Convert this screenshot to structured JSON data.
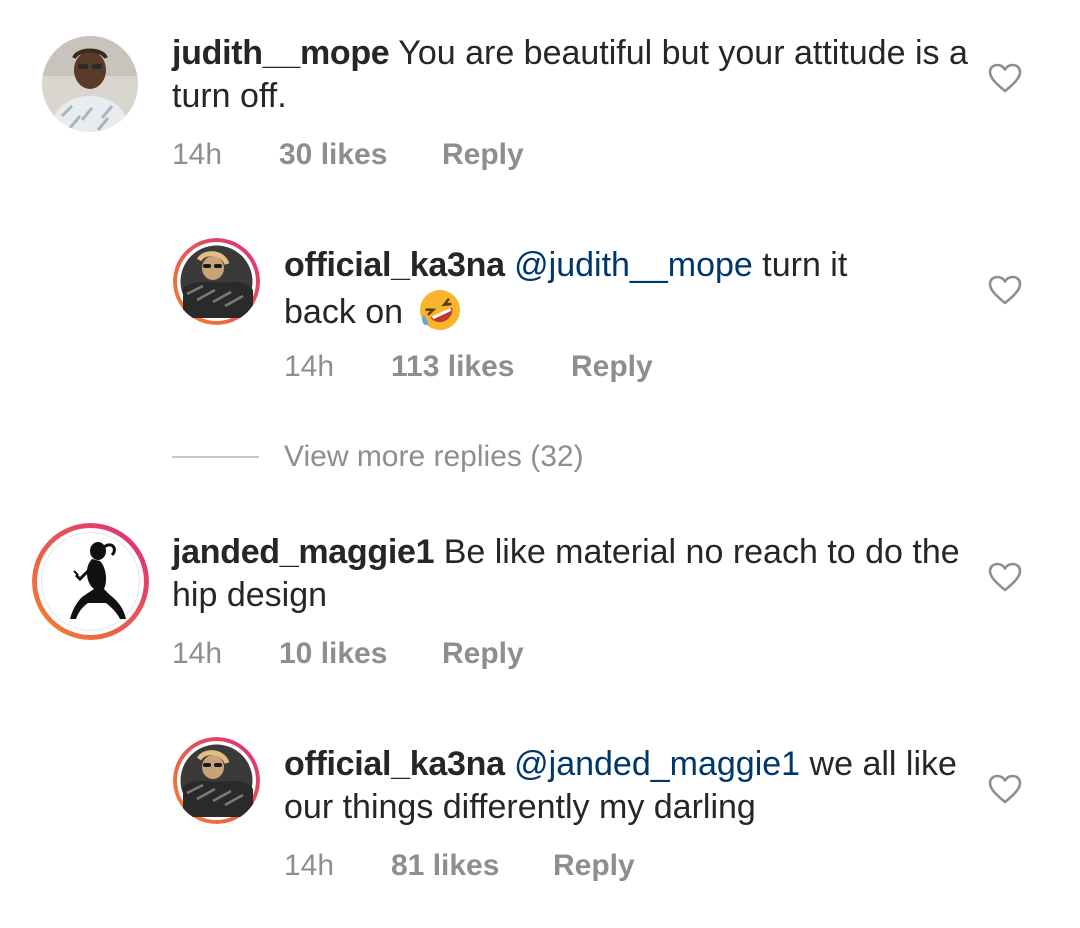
{
  "comments": [
    {
      "username": "judith__mope",
      "text": "You are beautiful but your attitude is a turn off.",
      "time": "14h",
      "likes": "30 likes",
      "reply_label": "Reply",
      "avatar_icon": "avatar-photo-man"
    },
    {
      "username": "official_ka3na",
      "mention": "@judith__mope",
      "text": "turn it back on",
      "emoji_icon": "rofl-emoji",
      "time": "14h",
      "likes": "113 likes",
      "reply_label": "Reply",
      "avatar_icon": "avatar-photo-woman"
    },
    {
      "username": "janded_maggie1",
      "text": "Be like material no reach to do the hip design",
      "time": "14h",
      "likes": "10 likes",
      "reply_label": "Reply",
      "avatar_icon": "avatar-silhouette-woman"
    },
    {
      "username": "official_ka3na",
      "mention": "@janded_maggie1",
      "text": "we all like our things differently my darling",
      "time": "14h",
      "likes": "81 likes",
      "reply_label": "Reply",
      "avatar_icon": "avatar-photo-woman"
    }
  ],
  "view_more": "View more replies (32)",
  "colors": {
    "text": "#262626",
    "meta": "#8e8e8e",
    "mention": "#00376b",
    "story_ring_start": "#f58529",
    "story_ring_end": "#dd2a7b"
  }
}
